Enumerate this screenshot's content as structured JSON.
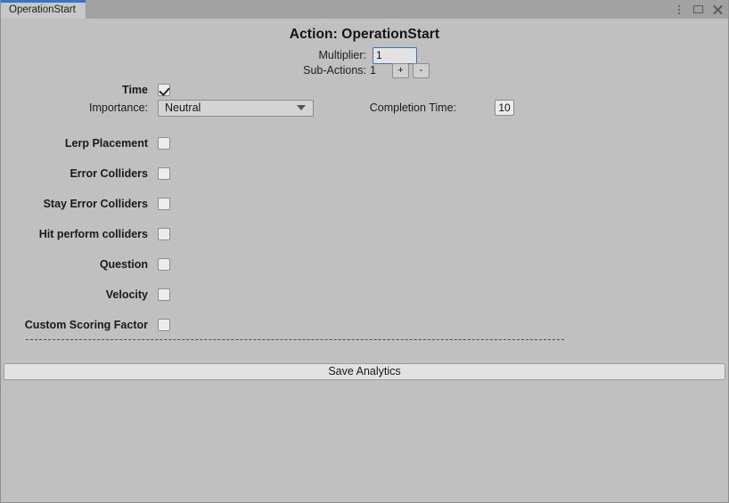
{
  "window": {
    "controls": [
      {
        "name": "kebab-menu-icon",
        "label": "More options"
      },
      {
        "name": "maximize-icon",
        "label": "Maximize"
      },
      {
        "name": "close-icon",
        "label": "Close"
      }
    ]
  },
  "tabs": [
    {
      "label": "OperationStart",
      "active": true
    }
  ],
  "header": {
    "title": "Action: OperationStart",
    "multiplier_label": "Multiplier:",
    "multiplier_value": "1",
    "subactions_label": "Sub-Actions:",
    "subactions_value": "1",
    "add_button_label": "+",
    "remove_button_label": "-"
  },
  "fields": {
    "time_label": "Time",
    "time_checked": true,
    "importance_label": "Importance:",
    "importance_value": "Neutral",
    "importance_options": [
      "Neutral"
    ],
    "completion_time_label": "Completion Time:",
    "completion_time_value": "10"
  },
  "toggles": [
    {
      "label": "Lerp Placement",
      "checked": false
    },
    {
      "label": "Error Colliders",
      "checked": false
    },
    {
      "label": "Stay Error Colliders",
      "checked": false
    },
    {
      "label": "Hit perform colliders",
      "checked": false
    },
    {
      "label": "Question",
      "checked": false
    },
    {
      "label": "Velocity",
      "checked": false
    },
    {
      "label": "Custom Scoring Factor",
      "checked": false
    }
  ],
  "footer": {
    "save_label": "Save Analytics"
  },
  "colors": {
    "background": "#c0c0c0",
    "tabbar": "#a2a2a2",
    "tab_active": "#c8c8c8",
    "tab_accent": "#3a74c8",
    "focus_border": "#3f6fb5",
    "button": "#e2e2e2"
  }
}
